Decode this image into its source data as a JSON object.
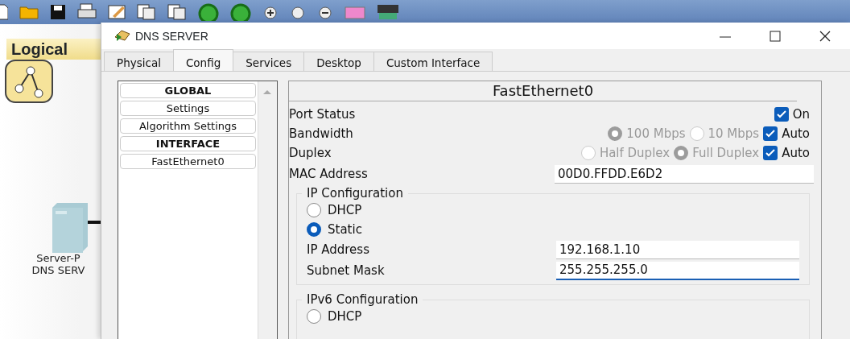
{
  "workspace": {
    "view_tab": "Logical",
    "device_label": [
      "Server-P",
      "DNS SERV"
    ]
  },
  "window": {
    "title": "DNS SERVER"
  },
  "tabs": [
    {
      "label": "Physical",
      "selected": false
    },
    {
      "label": "Config",
      "selected": true
    },
    {
      "label": "Services",
      "selected": false
    },
    {
      "label": "Desktop",
      "selected": false
    },
    {
      "label": "Custom Interface",
      "selected": false
    }
  ],
  "sidebar": {
    "items": [
      {
        "label": "GLOBAL",
        "kind": "header"
      },
      {
        "label": "Settings",
        "kind": "item"
      },
      {
        "label": "Algorithm Settings",
        "kind": "item"
      },
      {
        "label": "INTERFACE",
        "kind": "header"
      },
      {
        "label": "FastEthernet0",
        "kind": "item"
      }
    ]
  },
  "interface": {
    "title": "FastEthernet0",
    "port_status": {
      "label": "Port Status",
      "option": "On",
      "checked": true
    },
    "bandwidth": {
      "label": "Bandwidth",
      "options": [
        {
          "label": "100 Mbps",
          "selected": true
        },
        {
          "label": "10 Mbps",
          "selected": false
        }
      ],
      "auto": {
        "label": "Auto",
        "checked": true
      }
    },
    "duplex": {
      "label": "Duplex",
      "options": [
        {
          "label": "Half Duplex",
          "selected": false
        },
        {
          "label": "Full Duplex",
          "selected": true
        }
      ],
      "auto": {
        "label": "Auto",
        "checked": true
      }
    },
    "mac": {
      "label": "MAC Address",
      "value": "00D0.FFDD.E6D2"
    },
    "ip_config": {
      "title": "IP Configuration",
      "modes": [
        {
          "label": "DHCP",
          "selected": false
        },
        {
          "label": "Static",
          "selected": true
        }
      ],
      "fields": [
        {
          "label": "IP Address",
          "value": "192.168.1.10",
          "focused": false
        },
        {
          "label": "Subnet Mask",
          "value": "255.255.255.0",
          "focused": true
        }
      ]
    },
    "ipv6_config": {
      "title": "IPv6 Configuration",
      "modes": [
        {
          "label": "DHCP",
          "selected": false
        }
      ]
    }
  }
}
